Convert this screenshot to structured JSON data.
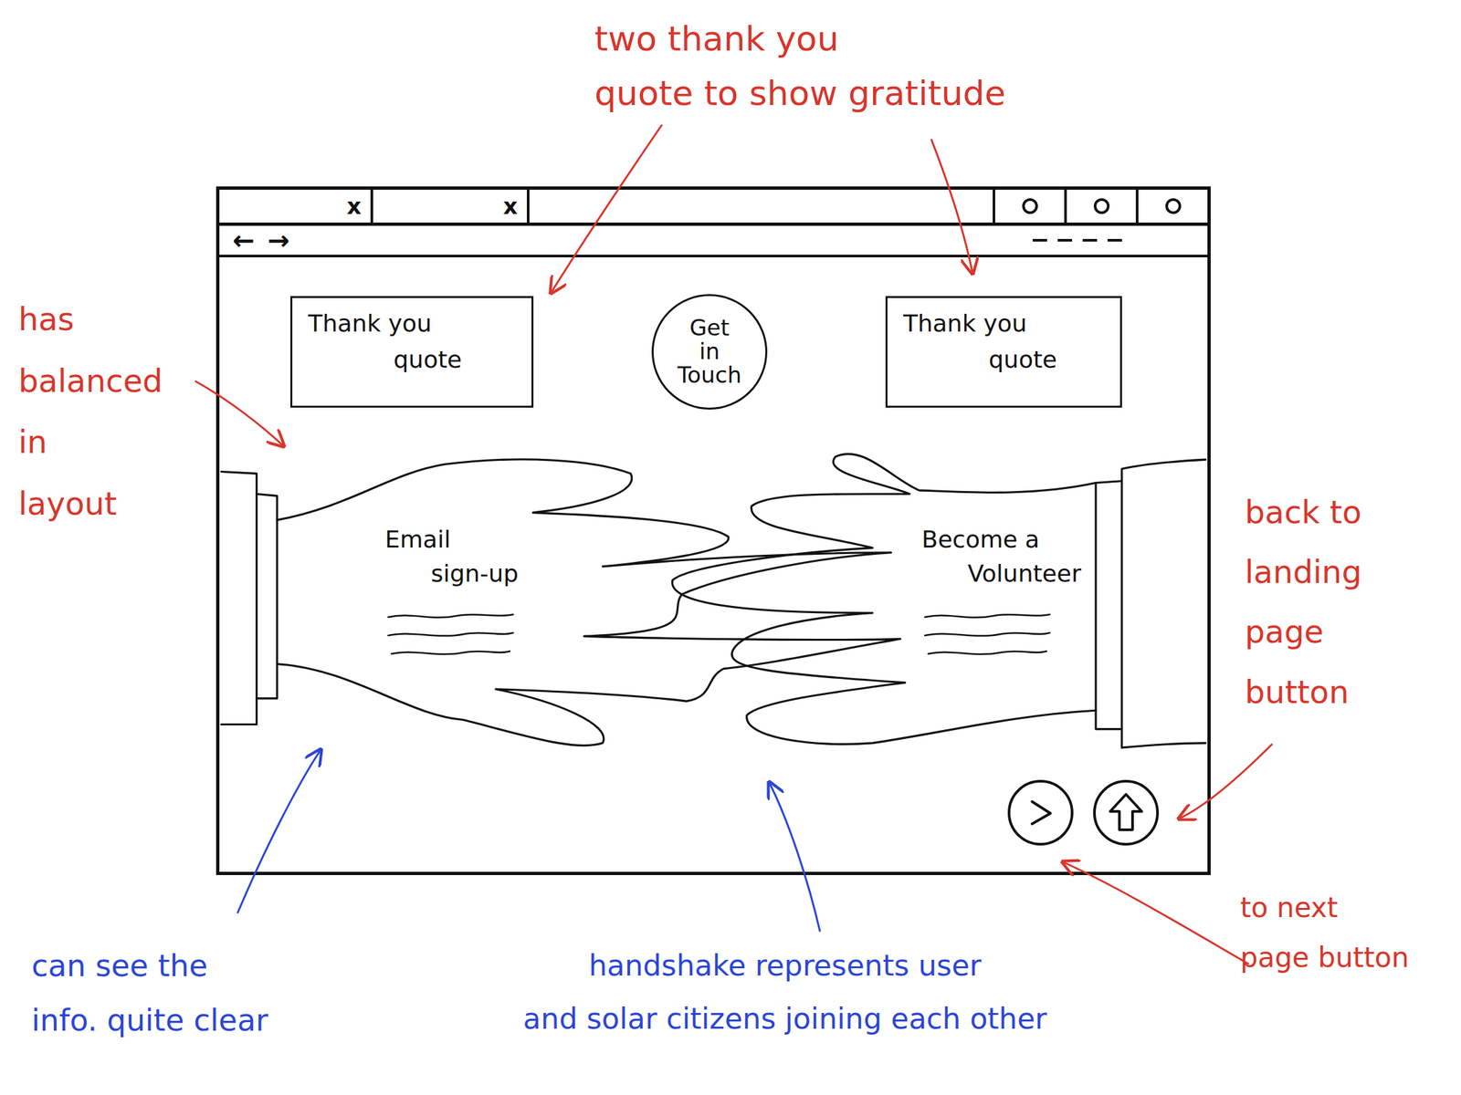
{
  "annotations": [
    {
      "lines": [
        "two thank you",
        "quote to show gratitude"
      ],
      "color": "#d8352b"
    },
    {
      "lines": [
        "has",
        "balanced",
        "in",
        "layout"
      ],
      "color": "#d8352b"
    },
    {
      "lines": [
        "back to",
        "landing",
        "page",
        "button"
      ],
      "color": "#d8352b"
    },
    {
      "lines": [
        "to next",
        "page button"
      ],
      "color": "#d8352b"
    },
    {
      "lines": [
        "can see the",
        "info. quite clear"
      ],
      "color": "#2b45d8"
    },
    {
      "lines": [
        "handshake represents user",
        "and solar citizens joining each other"
      ],
      "color": "#2b45d8"
    }
  ],
  "window": {
    "tabs": [
      {
        "close": "x"
      },
      {
        "close": "x"
      }
    ],
    "nav": {
      "back": "←",
      "forward": "→"
    }
  },
  "quotes": [
    {
      "title": "Thank you",
      "subtitle": "quote"
    },
    {
      "title": "Thank you",
      "subtitle": "quote"
    }
  ],
  "contact": {
    "lines": [
      "Get",
      "in",
      "Touch"
    ]
  },
  "hands": [
    {
      "lines": [
        "Email",
        "sign-up"
      ]
    },
    {
      "lines": [
        "Become a",
        "Volunteer"
      ]
    }
  ]
}
